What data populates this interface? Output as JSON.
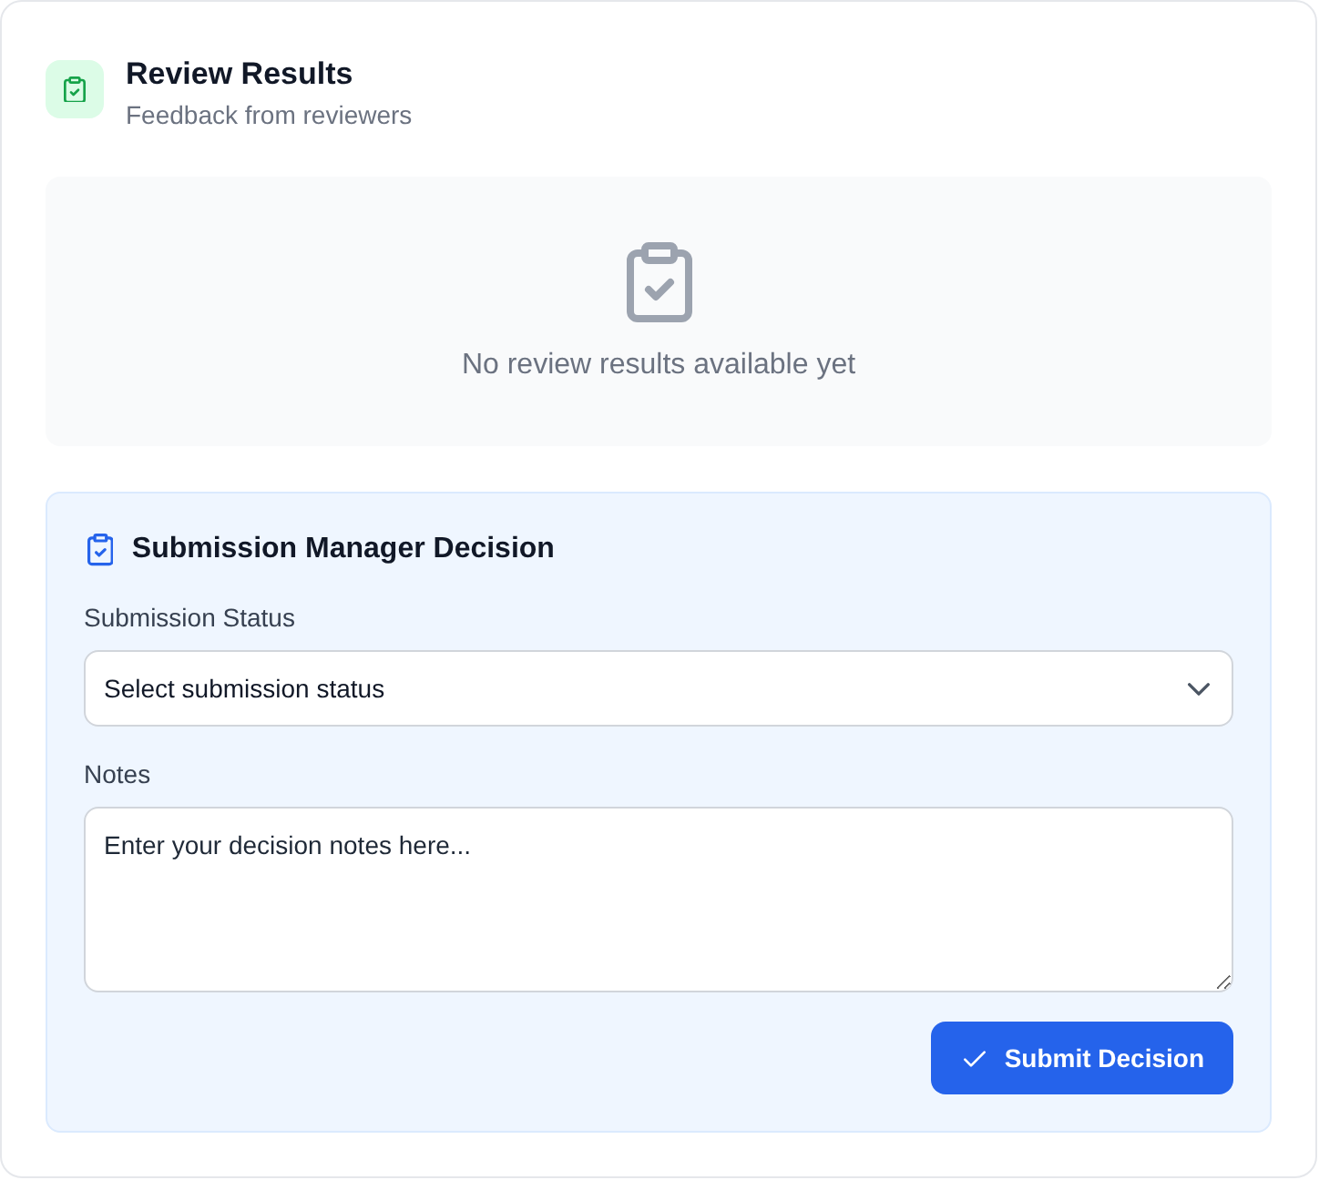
{
  "header": {
    "title": "Review Results",
    "subtitle": "Feedback from reviewers"
  },
  "empty_state": {
    "message": "No review results available yet"
  },
  "decision": {
    "title": "Submission Manager Decision",
    "fields": [
      {
        "kind": "select",
        "label": "Submission Status",
        "value": "Select submission status"
      },
      {
        "kind": "textarea",
        "label": "Notes",
        "placeholder": "Enter your decision notes here..."
      }
    ],
    "submit_button": "Submit Decision"
  }
}
